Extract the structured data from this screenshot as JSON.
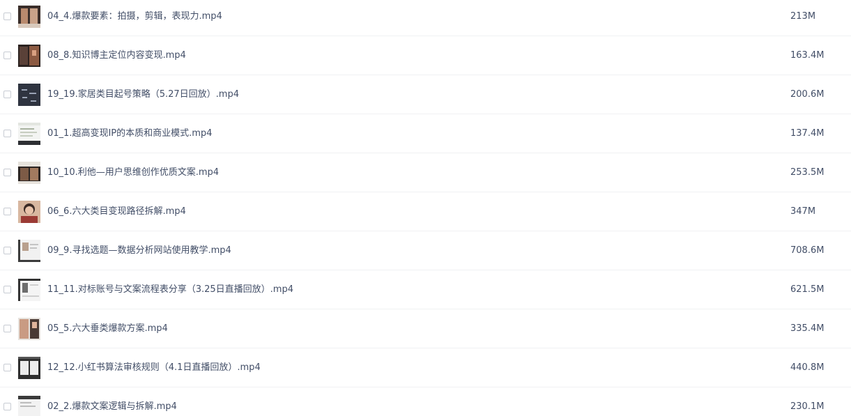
{
  "files": [
    {
      "name": "04_4.爆款要素：拍摄，剪辑，表现力.mp4",
      "size": "213M",
      "thumb": "video-thumbnail"
    },
    {
      "name": "08_8.知识博主定位内容变现.mp4",
      "size": "163.4M",
      "thumb": "video-thumbnail"
    },
    {
      "name": "19_19.家居类目起号策略（5.27日回放）.mp4",
      "size": "200.6M",
      "thumb": "video-thumbnail"
    },
    {
      "name": "01_1.超高变现IP的本质和商业模式.mp4",
      "size": "137.4M",
      "thumb": "video-thumbnail"
    },
    {
      "name": "10_10.利他—用户思维创作优质文案.mp4",
      "size": "253.5M",
      "thumb": "video-thumbnail"
    },
    {
      "name": "06_6.六大类目变现路径拆解.mp4",
      "size": "347M",
      "thumb": "video-thumbnail"
    },
    {
      "name": "09_9.寻找选题—数据分析网站使用教学.mp4",
      "size": "708.6M",
      "thumb": "video-thumbnail"
    },
    {
      "name": "11_11.对标账号与文案流程表分享（3.25日直播回放）.mp4",
      "size": "621.5M",
      "thumb": "video-thumbnail"
    },
    {
      "name": "05_5.六大垂类爆款方案.mp4",
      "size": "335.4M",
      "thumb": "video-thumbnail"
    },
    {
      "name": "12_12.小红书算法审核规则（4.1日直播回放）.mp4",
      "size": "440.8M",
      "thumb": "video-thumbnail"
    },
    {
      "name": "02_2.爆款文案逻辑与拆解.mp4",
      "size": "230.1M",
      "thumb": "video-thumbnail"
    }
  ]
}
